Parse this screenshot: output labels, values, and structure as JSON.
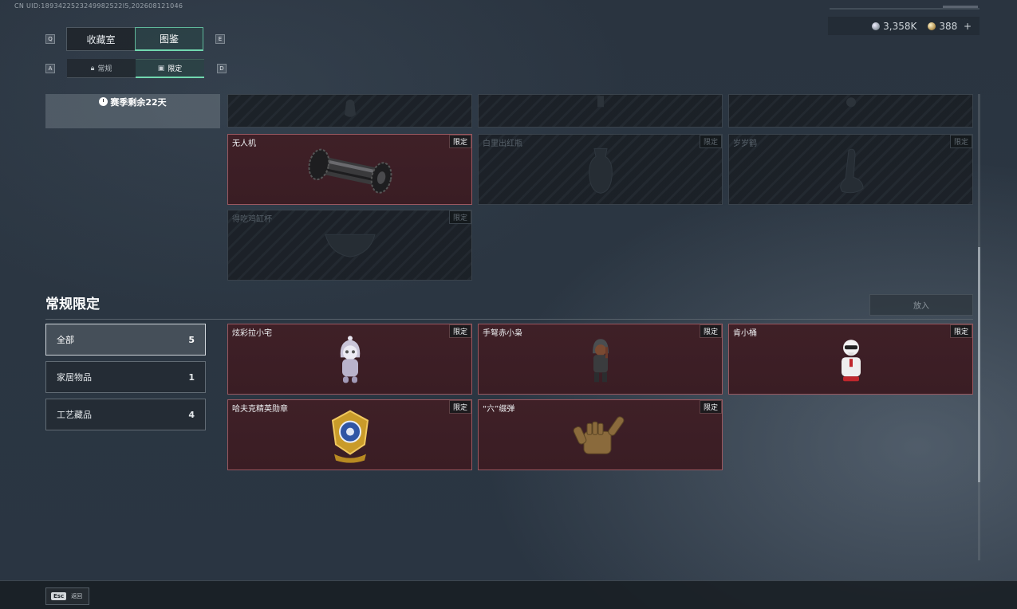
{
  "header": {
    "uid": "CN UID:1893422523249982522I5,202608121046",
    "currency": [
      {
        "icon": "silver-coin-icon",
        "value": "3,358K"
      },
      {
        "icon": "gold-coin-icon",
        "value": "388"
      }
    ],
    "add_symbol": "+"
  },
  "tabs": {
    "prev_key": "Q",
    "next_key": "E",
    "main": [
      {
        "label": "收藏室",
        "active": false
      },
      {
        "label": "图鉴",
        "active": true
      }
    ],
    "sub_prev_key": "A",
    "sub_next_key": "D",
    "sub": [
      {
        "label": "常规",
        "icon": "lock-icon",
        "active": false
      },
      {
        "label": "限定",
        "icon": "image-icon",
        "active": true
      }
    ]
  },
  "season": {
    "remaining": "赛季剩余22天"
  },
  "seasonal_cards": [
    {
      "name": "",
      "badge": "",
      "state": "locked"
    },
    {
      "name": "",
      "badge": "",
      "state": "locked"
    },
    {
      "name": "",
      "badge": "",
      "state": "locked"
    },
    {
      "name": "无人机",
      "badge": "限定",
      "state": "owned"
    },
    {
      "name": "白里出红瓶",
      "badge": "限定",
      "state": "locked"
    },
    {
      "name": "岁岁鹤",
      "badge": "限定",
      "state": "locked"
    },
    {
      "name": "得吃鸡缸杯",
      "badge": "限定",
      "state": "locked"
    }
  ],
  "section": {
    "title": "常规限定",
    "place_button": "放入",
    "categories": [
      {
        "label": "全部",
        "count": "5",
        "active": true
      },
      {
        "label": "家居物品",
        "count": "1",
        "active": false
      },
      {
        "label": "工艺藏品",
        "count": "4",
        "active": false
      }
    ],
    "cards": [
      {
        "name": "炫彩拉小宅",
        "badge": "限定",
        "state": "owned"
      },
      {
        "name": "手弩赤小枭",
        "badge": "限定",
        "state": "owned"
      },
      {
        "name": "肯小桶",
        "badge": "限定",
        "state": "owned"
      },
      {
        "name": "哈夫克精英勋章",
        "badge": "限定",
        "state": "owned"
      },
      {
        "name": "“六”缀弹",
        "badge": "限定",
        "state": "owned"
      }
    ]
  },
  "footer": {
    "esc_key": "Esc",
    "back_label": "返回"
  }
}
